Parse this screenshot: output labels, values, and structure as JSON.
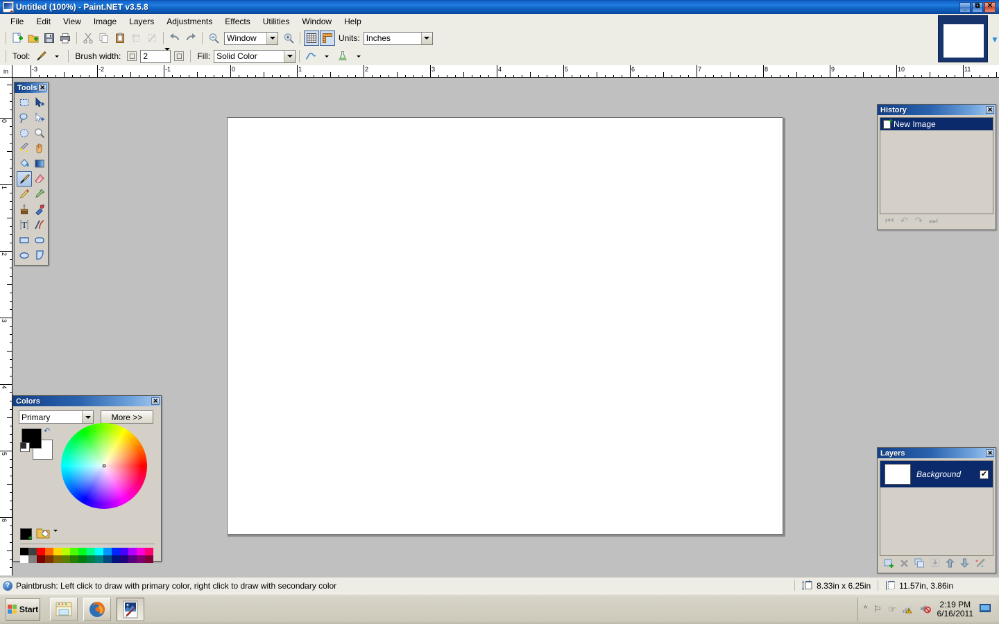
{
  "window": {
    "title": "Untitled (100%) - Paint.NET v3.5.8",
    "app_icon": "paintnet-icon",
    "minimize_label": "_",
    "restore_label": "❐",
    "close_label": "✕"
  },
  "menubar": {
    "items": [
      {
        "label": "File"
      },
      {
        "label": "Edit"
      },
      {
        "label": "View"
      },
      {
        "label": "Image"
      },
      {
        "label": "Layers"
      },
      {
        "label": "Adjustments"
      },
      {
        "label": "Effects"
      },
      {
        "label": "Utilities"
      },
      {
        "label": "Window"
      },
      {
        "label": "Help"
      }
    ]
  },
  "toolbar_main": {
    "buttons": [
      {
        "name": "new-image-button",
        "icon": "new-document-icon",
        "title": "New"
      },
      {
        "name": "open-image-button",
        "icon": "open-folder-icon",
        "title": "Open"
      },
      {
        "name": "save-image-button",
        "icon": "floppy-disk-icon",
        "title": "Save"
      },
      {
        "name": "print-image-button",
        "icon": "printer-icon",
        "title": "Print"
      },
      {
        "name": "cut-button",
        "icon": "scissors-icon",
        "title": "Cut"
      },
      {
        "name": "copy-button",
        "icon": "copy-icon",
        "title": "Copy"
      },
      {
        "name": "paste-button",
        "icon": "clipboard-icon",
        "title": "Paste"
      },
      {
        "name": "crop-to-selection-button",
        "icon": "crop-icon",
        "title": "Crop to Selection"
      },
      {
        "name": "deselect-all-button",
        "icon": "deselect-icon",
        "title": "Deselect All"
      },
      {
        "name": "undo-button",
        "icon": "undo-arrow-icon",
        "title": "Undo"
      },
      {
        "name": "redo-button",
        "icon": "redo-arrow-icon",
        "title": "Redo"
      },
      {
        "name": "zoom-out-button",
        "icon": "zoom-out-icon",
        "title": "Zoom Out"
      }
    ],
    "zoom_value": "Window",
    "zoom_in_icon": "zoom-in-icon",
    "grid_toggle_icon": "grid-icon",
    "rulers_toggle_icon": "ruler-icon",
    "units_label": "Units:",
    "units_value": "Inches"
  },
  "toolbar_tool_options": {
    "tool_label": "Tool:",
    "tool_icon": "paintbrush-icon",
    "brush_width_label": "Brush width:",
    "brush_width_value": "2",
    "decrement_label": "⊟",
    "increment_label": "⊞",
    "fill_label": "Fill:",
    "fill_value": "Solid Color",
    "antialias_icon": "antialiasing-curve-icon",
    "blend_mode_icon": "blend-flask-icon"
  },
  "rulers": {
    "unit_corner_label": "in",
    "horizontal_labels": [
      "-3",
      "-2",
      "-1",
      "0",
      "1",
      "2",
      "3",
      "4",
      "5",
      "6",
      "7",
      "8",
      "9",
      "10",
      "11"
    ],
    "vertical_labels": [
      "0",
      "1",
      "2",
      "3",
      "4",
      "5",
      "6"
    ]
  },
  "tools_palette": {
    "title": "Tools",
    "close_label": "✕",
    "active_tool": "paintbrush",
    "tools": [
      {
        "name": "rectangle-select-tool",
        "icon": "rectangle-select-icon"
      },
      {
        "name": "move-selected-tool",
        "icon": "move-selected-icon"
      },
      {
        "name": "lasso-select-tool",
        "icon": "lasso-select-icon"
      },
      {
        "name": "move-selection-tool",
        "icon": "move-selection-icon"
      },
      {
        "name": "ellipse-select-tool",
        "icon": "ellipse-select-icon"
      },
      {
        "name": "zoom-tool",
        "icon": "magnifier-icon"
      },
      {
        "name": "magic-wand-tool",
        "icon": "magic-wand-icon"
      },
      {
        "name": "pan-tool",
        "icon": "hand-icon"
      },
      {
        "name": "paint-bucket-tool",
        "icon": "paint-bucket-icon"
      },
      {
        "name": "gradient-tool",
        "icon": "gradient-icon"
      },
      {
        "name": "paintbrush-tool",
        "icon": "paintbrush-icon"
      },
      {
        "name": "eraser-tool",
        "icon": "eraser-icon"
      },
      {
        "name": "pencil-tool",
        "icon": "pencil-icon"
      },
      {
        "name": "color-picker-tool",
        "icon": "eyedropper-icon"
      },
      {
        "name": "clone-stamp-tool",
        "icon": "clone-stamp-icon"
      },
      {
        "name": "recolor-tool",
        "icon": "recolor-icon"
      },
      {
        "name": "text-tool",
        "icon": "text-t-icon"
      },
      {
        "name": "line-curve-tool",
        "icon": "line-curve-icon"
      },
      {
        "name": "rectangle-tool",
        "icon": "rectangle-shape-icon"
      },
      {
        "name": "rounded-rectangle-tool",
        "icon": "rounded-rectangle-icon"
      },
      {
        "name": "ellipse-tool",
        "icon": "ellipse-shape-icon"
      },
      {
        "name": "freeform-shape-tool",
        "icon": "freeform-shape-icon"
      }
    ]
  },
  "colors_palette": {
    "title": "Colors",
    "close_label": "✕",
    "channel_value": "Primary",
    "more_label": "More >>",
    "primary_color": "#000000",
    "secondary_color": "#ffffff",
    "swap_icon": "swap-colors-icon",
    "reset_icon": "reset-colors-icon",
    "add_color_icon": "add-palette-color-icon",
    "open_palette_icon": "open-palette-icon",
    "palette_caret_icon": "chevron-down-icon",
    "wheel_icon": "color-wheel",
    "swatches_row1": [
      "#000000",
      "#404040",
      "#ff0000",
      "#ff6a00",
      "#ffd800",
      "#b6ff00",
      "#4cff00",
      "#00ff21",
      "#00ff90",
      "#00ffff",
      "#0094ff",
      "#0026ff",
      "#4800ff",
      "#b200ff",
      "#ff00dc",
      "#ff006e"
    ],
    "swatches_row2": [
      "#ffffff",
      "#808080",
      "#7f0000",
      "#7f3300",
      "#7f6a00",
      "#5b7f00",
      "#267f00",
      "#007f0e",
      "#007f46",
      "#007f7f",
      "#004a7f",
      "#00137f",
      "#21007f",
      "#57007f",
      "#7f006e",
      "#7f0037"
    ]
  },
  "history_palette": {
    "title": "History",
    "close_label": "✕",
    "items": [
      {
        "label": "New Image",
        "icon": "new-image-icon",
        "selected": true
      }
    ],
    "buttons": [
      {
        "name": "history-rewind-button",
        "icon": "rewind-icon",
        "glyph": "⏮"
      },
      {
        "name": "history-undo-button",
        "icon": "undo-arrow-icon",
        "glyph": "↶"
      },
      {
        "name": "history-redo-button",
        "icon": "redo-arrow-icon",
        "glyph": "↷"
      },
      {
        "name": "history-fastforward-button",
        "icon": "fast-forward-icon",
        "glyph": "⏭"
      }
    ]
  },
  "layers_palette": {
    "title": "Layers",
    "close_label": "✕",
    "layers": [
      {
        "name": "Background",
        "visible": true,
        "check_glyph": "✔"
      }
    ],
    "buttons": [
      {
        "name": "add-layer-button",
        "icon": "add-layer-icon",
        "glyph": "➕"
      },
      {
        "name": "delete-layer-button",
        "icon": "delete-layer-icon",
        "glyph": "✖"
      },
      {
        "name": "duplicate-layer-button",
        "icon": "duplicate-layer-icon",
        "glyph": "⧉"
      },
      {
        "name": "merge-layer-down-button",
        "icon": "merge-down-icon",
        "glyph": "⇩"
      },
      {
        "name": "move-layer-up-button",
        "icon": "arrow-up-icon",
        "glyph": "⬆"
      },
      {
        "name": "move-layer-down-button",
        "icon": "arrow-down-icon",
        "glyph": "⬇"
      },
      {
        "name": "layer-properties-button",
        "icon": "layer-properties-icon",
        "glyph": "✎"
      }
    ]
  },
  "statusbar": {
    "help_icon": "help-question-icon",
    "message": "Paintbrush: Left click to draw with primary color, right click to draw with secondary color",
    "image_size_icon": "image-size-icon",
    "image_size": "8.33in x 6.25in",
    "cursor_position_icon": "cursor-position-icon",
    "cursor_position": "11.57in, 3.86in"
  },
  "taskbar": {
    "start_label": "Start",
    "start_icon": "windows-logo-icon",
    "apps": [
      {
        "name": "taskbar-explorer-button",
        "icon": "folder-icon",
        "active": false
      },
      {
        "name": "taskbar-firefox-button",
        "icon": "firefox-icon",
        "active": false
      },
      {
        "name": "taskbar-paintnet-button",
        "icon": "paintnet-icon",
        "active": true
      }
    ],
    "tray_icons": [
      {
        "name": "show-hidden-icons-button",
        "icon": "chevron-up-icon",
        "glyph": "«"
      },
      {
        "name": "tray-flag-button",
        "icon": "flag-icon",
        "glyph": "⚑"
      },
      {
        "name": "tray-hand-button",
        "icon": "hand-icon",
        "glyph": "☞"
      },
      {
        "name": "tray-network-button",
        "icon": "network-warning-icon",
        "glyph": "◢"
      },
      {
        "name": "tray-volume-button",
        "icon": "volume-muted-icon",
        "glyph": "🔈"
      }
    ],
    "clock_time": "2:19 PM",
    "clock_date": "6/16/2011",
    "show_desktop_icon": "show-desktop-icon"
  },
  "thumbnail_widget": {
    "name": "image-thumbnail-strip",
    "scroll_icon": "thumbnail-scroll-icon"
  },
  "theme": {
    "title_blue": "#1f6fd0",
    "palette_bg": "#d4d0c8",
    "toolbar_bg": "#eeede5",
    "selection_blue": "#0b2a6b",
    "canvas_bg": "#c0c0c0"
  }
}
